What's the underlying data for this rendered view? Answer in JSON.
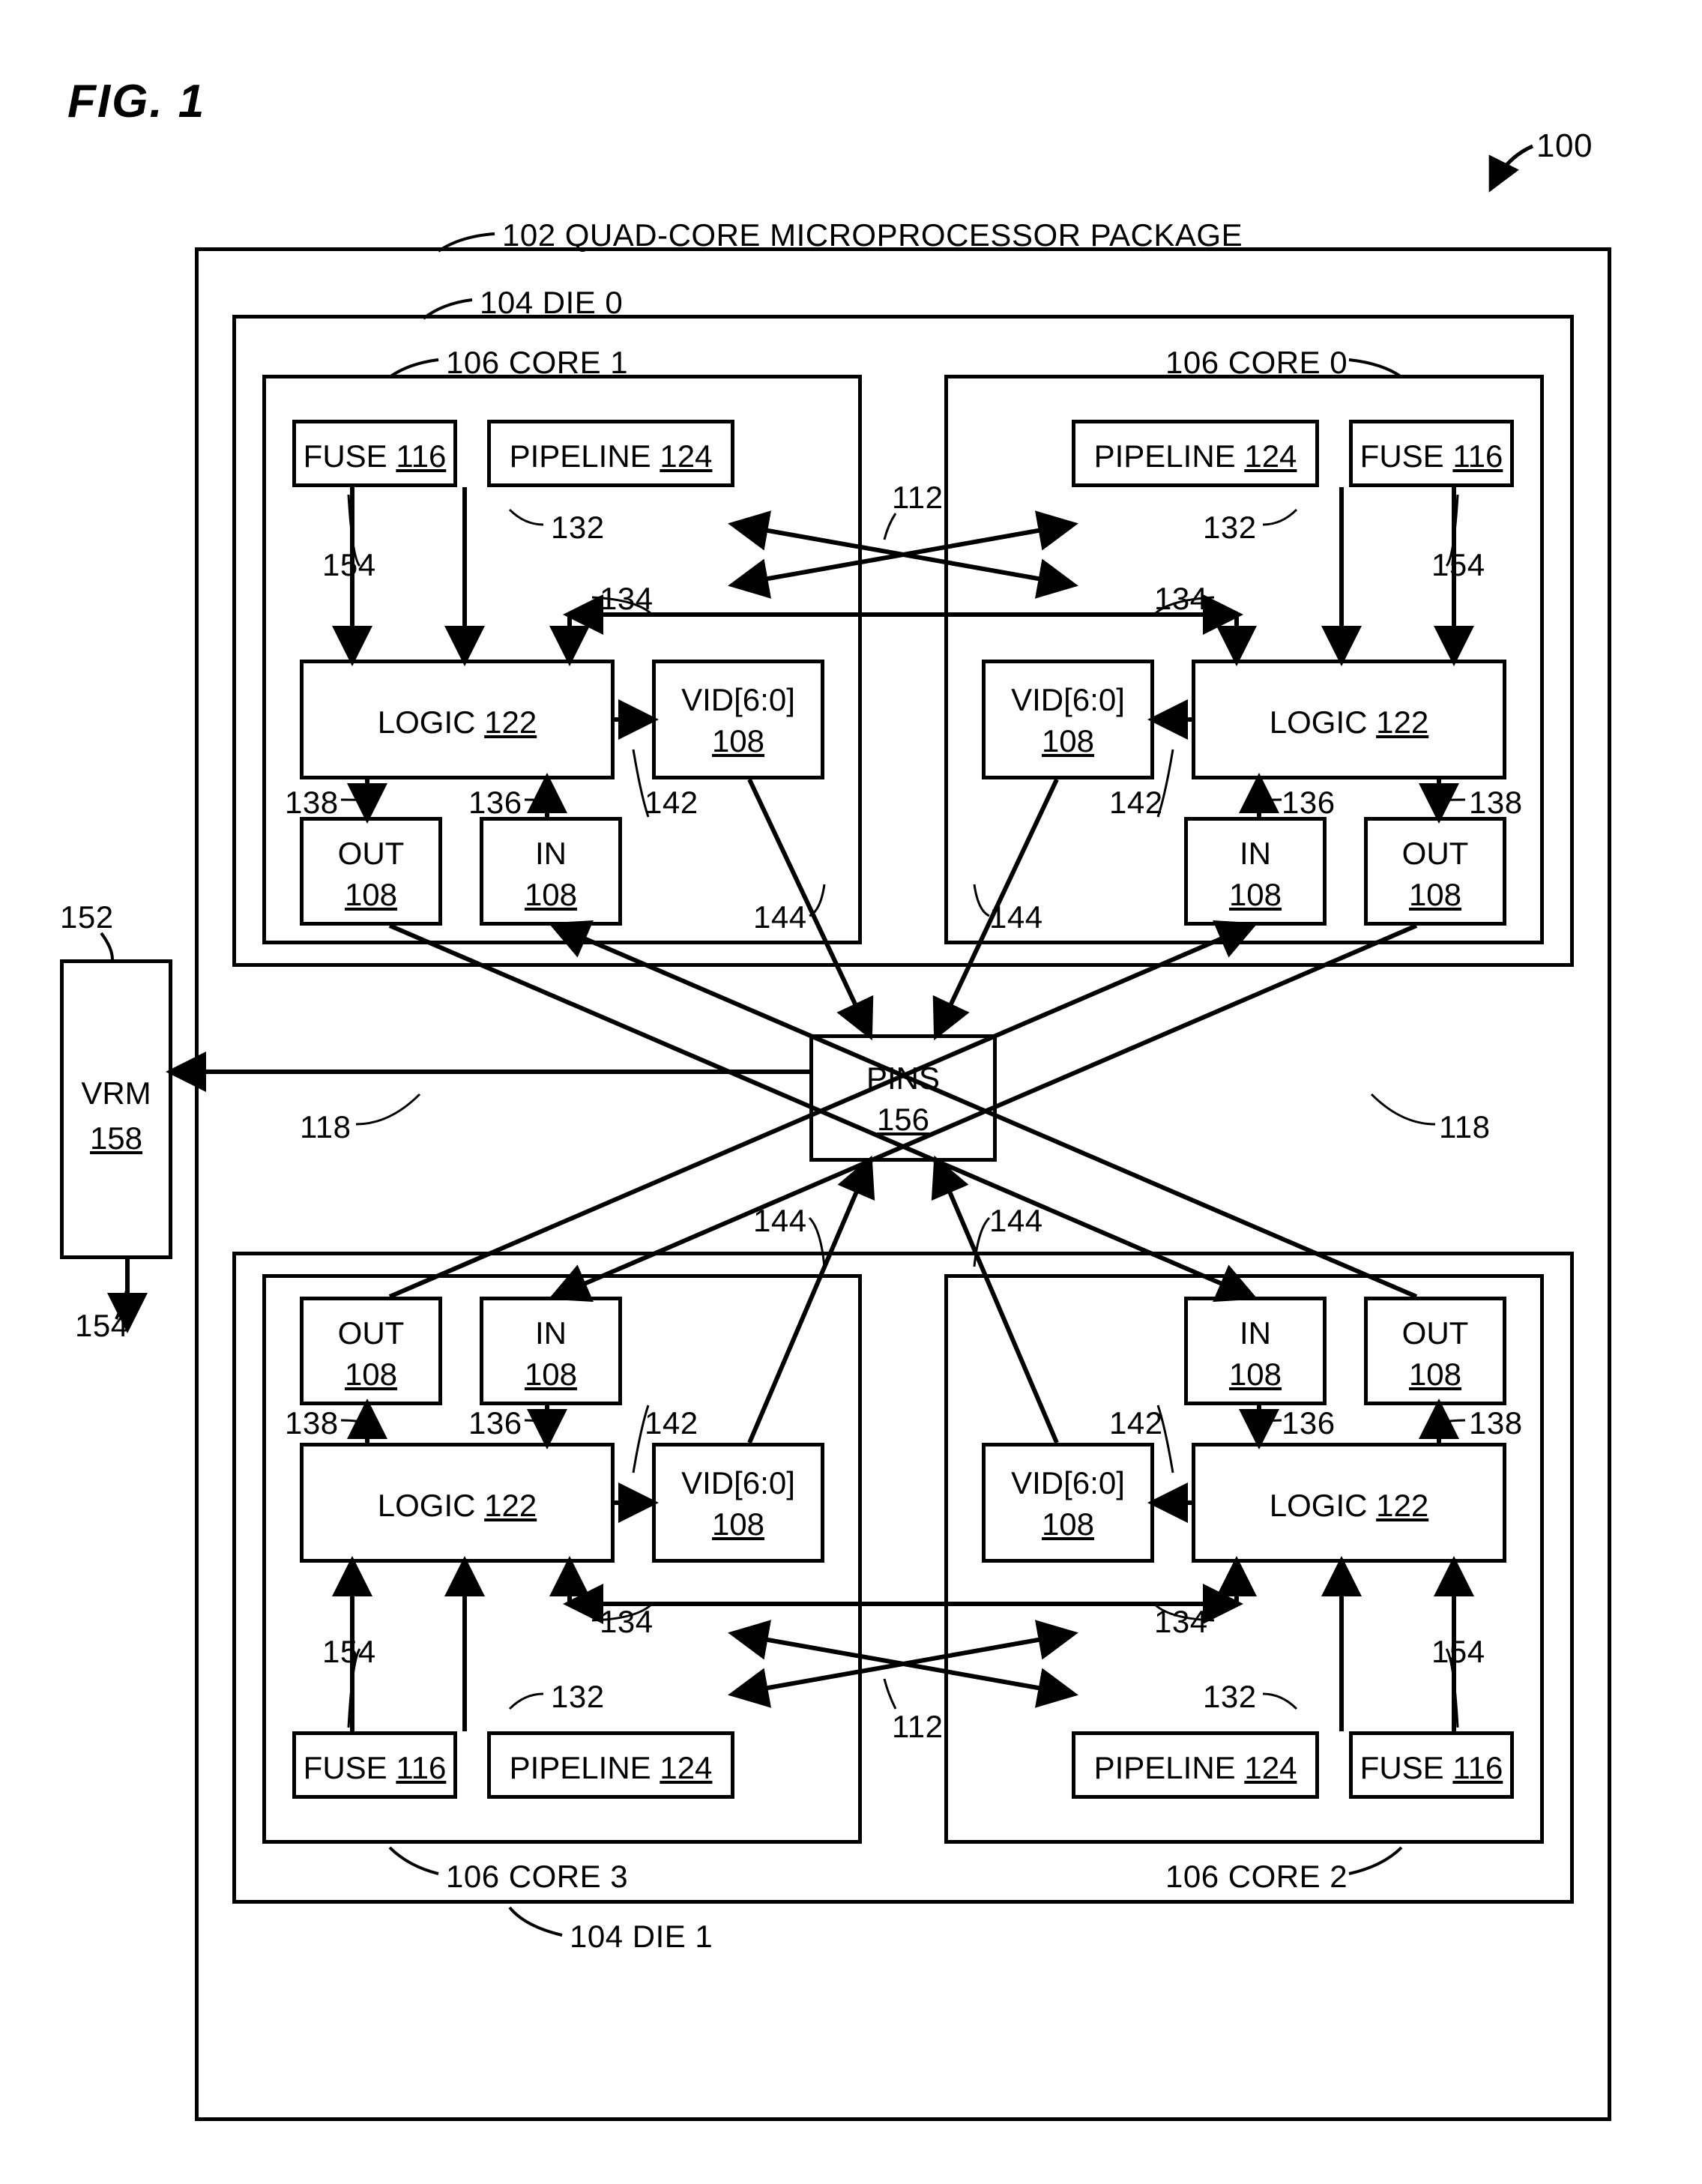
{
  "figure": {
    "title": "FIG. 1"
  },
  "refs": {
    "fig": "100",
    "pkg": "102 QUAD-CORE MICROPROCESSOR PACKAGE",
    "die0": "104 DIE 0",
    "die1": "104 DIE 1",
    "core0": "106 CORE 0",
    "core1": "106 CORE 1",
    "core2": "106 CORE 2",
    "core3": "106 CORE 3",
    "r112a": "112",
    "r112b": "112",
    "r132a": "132",
    "r132b": "132",
    "r132c": "132",
    "r132d": "132",
    "r134a": "134",
    "r134b": "134",
    "r134c": "134",
    "r134d": "134",
    "r136a": "136",
    "r136b": "136",
    "r136c": "136",
    "r136d": "136",
    "r138a": "138",
    "r138b": "138",
    "r138c": "138",
    "r138d": "138",
    "r142a": "142",
    "r142b": "142",
    "r142c": "142",
    "r142d": "142",
    "r144a": "144",
    "r144b": "144",
    "r144c": "144",
    "r144d": "144",
    "r118a": "118",
    "r118b": "118",
    "r152": "152",
    "r154a": "154",
    "r154b": "154",
    "r154c": "154",
    "r154d": "154",
    "r154e": "154"
  },
  "blocks": {
    "fuse": {
      "name": "FUSE",
      "num": "116"
    },
    "pipeline": {
      "name": "PIPELINE",
      "num": "124"
    },
    "logic": {
      "name": "LOGIC",
      "num": "122"
    },
    "vid": {
      "name": "VID[6:0]",
      "num": "108"
    },
    "out": {
      "name": "OUT",
      "num": "108"
    },
    "in": {
      "name": "IN",
      "num": "108"
    },
    "vrm": {
      "name": "VRM",
      "num": "158"
    },
    "pins": {
      "name": "PINS",
      "num": "156"
    }
  }
}
